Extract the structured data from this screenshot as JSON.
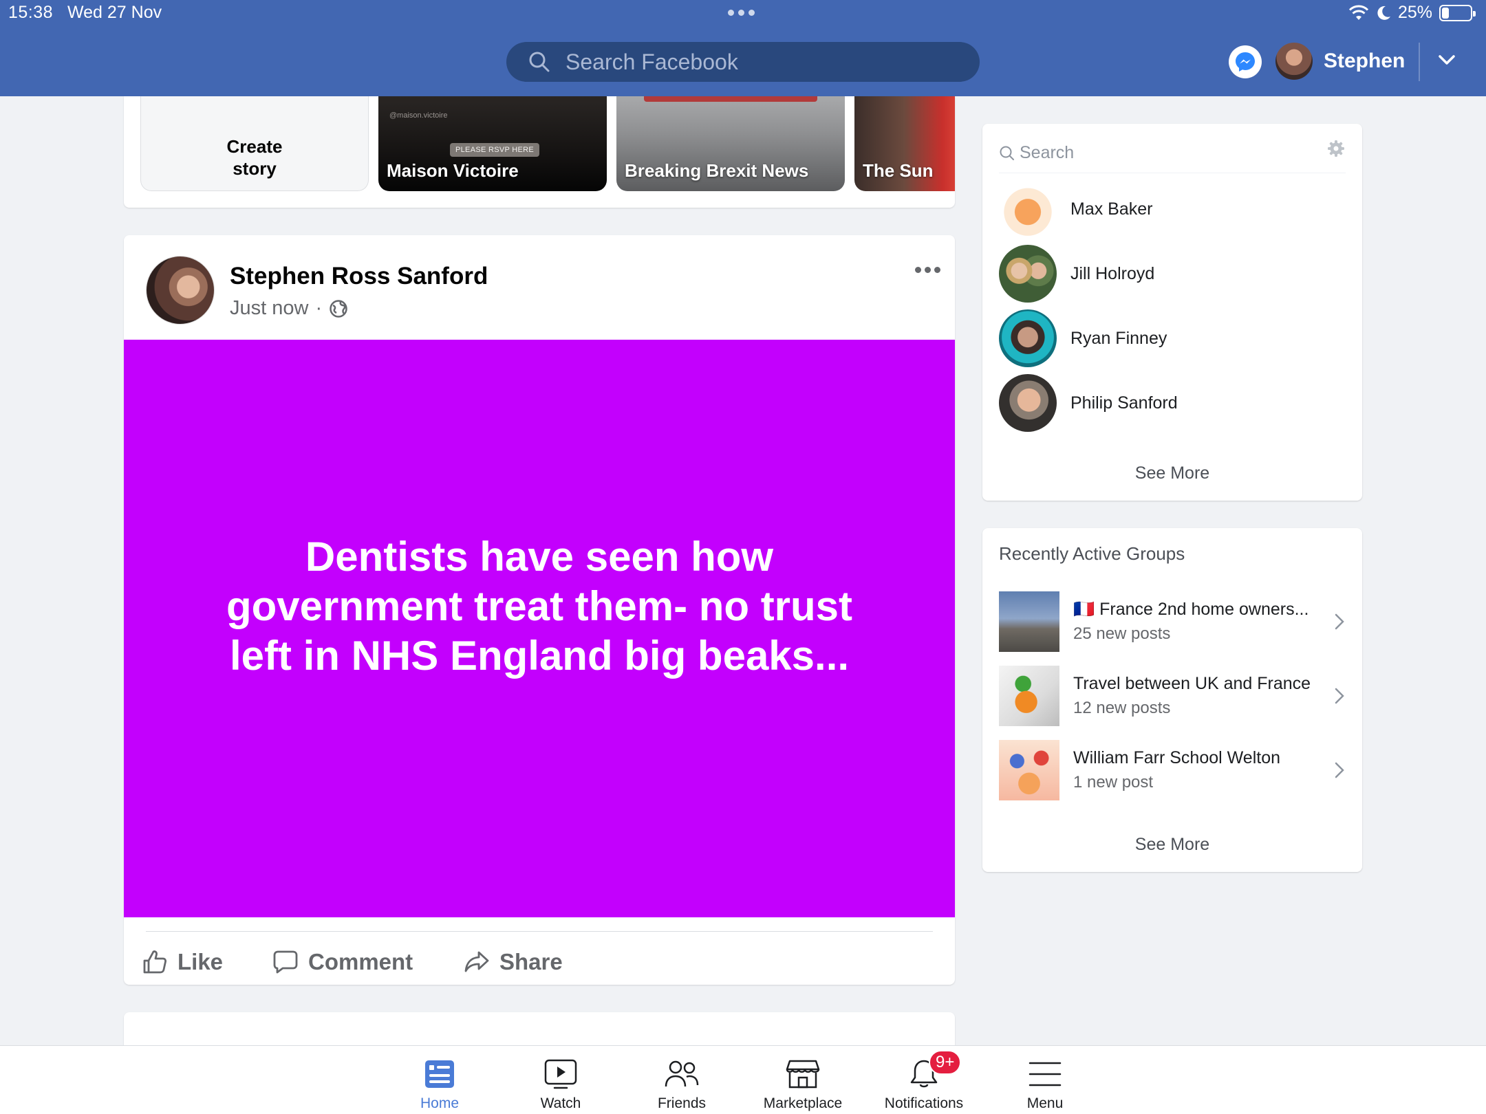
{
  "status_bar": {
    "time": "15:38",
    "date": "Wed 27 Nov",
    "battery": "25%",
    "battery_level": 0.25
  },
  "header": {
    "search_placeholder": "Search Facebook",
    "user_name": "Stephen",
    "brand_color": "#4267b2",
    "icons": [
      "search-icon",
      "messenger-icon",
      "chevron-down-icon"
    ]
  },
  "stories": {
    "create_label": "Create story",
    "items": [
      {
        "label": "Maison Victoire",
        "handle": "@maison.victoire",
        "badge": "PLEASE RSVP HERE"
      },
      {
        "label": "Breaking Brexit News"
      },
      {
        "label": "The Sun"
      }
    ]
  },
  "post": {
    "author": "Stephen Ross Sanford",
    "time": "Just now",
    "separator": "·",
    "privacy_icon": "globe-icon",
    "text": "Dentists have seen how government treat them- no trust left in NHS England big beaks...",
    "background_color": "#c300fd",
    "actions": {
      "like": "Like",
      "comment": "Comment",
      "share": "Share"
    }
  },
  "contacts": {
    "search_placeholder": "Search",
    "items": [
      {
        "name": "Max Baker"
      },
      {
        "name": "Jill Holroyd"
      },
      {
        "name": "Ryan Finney"
      },
      {
        "name": "Philip Sanford"
      }
    ],
    "see_more": "See More"
  },
  "groups": {
    "title": "Recently Active Groups",
    "items": [
      {
        "flag": "🇫🇷",
        "name": "France 2nd home owners...",
        "sub": "25 new posts"
      },
      {
        "name": "Travel between UK and France",
        "sub": "12 new posts"
      },
      {
        "name": "William Farr School Welton",
        "sub": "1 new post"
      }
    ],
    "see_more": "See More"
  },
  "tabbar": {
    "tabs": [
      {
        "label": "Home",
        "icon": "home-icon",
        "active": true
      },
      {
        "label": "Watch",
        "icon": "watch-icon"
      },
      {
        "label": "Friends",
        "icon": "friends-icon"
      },
      {
        "label": "Marketplace",
        "icon": "marketplace-icon"
      },
      {
        "label": "Notifications",
        "icon": "bell-icon",
        "badge": "9+"
      },
      {
        "label": "Menu",
        "icon": "menu-icon"
      }
    ],
    "active_color": "#4a7bd6"
  }
}
